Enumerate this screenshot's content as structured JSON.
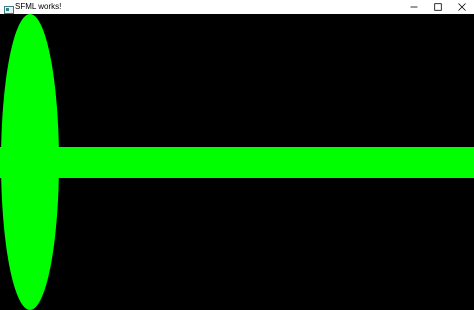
{
  "window": {
    "title": "SFML works!",
    "controls": {
      "minimize_icon": "minimize-icon",
      "maximize_icon": "maximize-icon",
      "close_icon": "close-icon"
    }
  },
  "scene": {
    "background_color": "#000000",
    "shape_color": "#00ff00",
    "shapes": [
      "ellipse",
      "horizontal-bar"
    ]
  }
}
